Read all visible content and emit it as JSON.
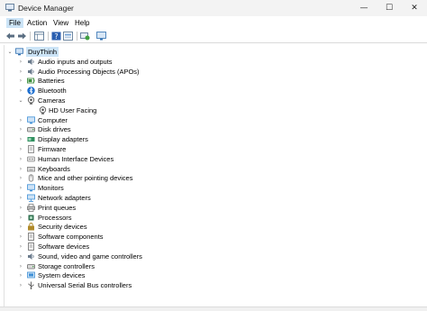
{
  "window": {
    "title": "Device Manager",
    "controls": {
      "minimize": "—",
      "maximize": "☐",
      "close": "✕"
    }
  },
  "menu": [
    {
      "label": "File"
    },
    {
      "label": "Action"
    },
    {
      "label": "View"
    },
    {
      "label": "Help"
    }
  ],
  "toolbar": [
    {
      "icon": "back-arrow-icon"
    },
    {
      "icon": "forward-arrow-icon"
    },
    {
      "icon": "properties-grid-icon"
    },
    {
      "icon": "help-question-icon"
    },
    {
      "icon": "update-driver-icon"
    },
    {
      "icon": "scan-hardware-icon"
    },
    {
      "icon": "monitor-display-icon"
    }
  ],
  "tree": {
    "root": {
      "label": "DuyThinh",
      "expanded": true
    },
    "categories": [
      {
        "label": "Audio inputs and outputs",
        "icon": "speaker-icon",
        "color": "#6b7b8c"
      },
      {
        "label": "Audio Processing Objects (APOs)",
        "icon": "speaker-icon",
        "color": "#6b7b8c"
      },
      {
        "label": "Batteries",
        "icon": "battery-icon",
        "color": "#3f8f3f"
      },
      {
        "label": "Bluetooth",
        "icon": "bluetooth-icon",
        "color": "#1e6fd0"
      },
      {
        "label": "Cameras",
        "icon": "camera-icon",
        "color": "#555555",
        "expanded": true,
        "children": [
          {
            "label": "HD User Facing",
            "icon": "camera-icon",
            "color": "#555555"
          }
        ]
      },
      {
        "label": "Computer",
        "icon": "computer-icon",
        "color": "#3d8fd6"
      },
      {
        "label": "Disk drives",
        "icon": "disk-drive-icon",
        "color": "#6b6b6b"
      },
      {
        "label": "Display adapters",
        "icon": "display-adapter-icon",
        "color": "#2f8f5f"
      },
      {
        "label": "Firmware",
        "icon": "firmware-icon",
        "color": "#7a7a7a"
      },
      {
        "label": "Human Interface Devices",
        "icon": "hid-icon",
        "color": "#8a8a8a"
      },
      {
        "label": "Keyboards",
        "icon": "keyboard-icon",
        "color": "#7a7a7a"
      },
      {
        "label": "Mice and other pointing devices",
        "icon": "mouse-icon",
        "color": "#7a7a7a"
      },
      {
        "label": "Monitors",
        "icon": "monitor-icon",
        "color": "#3d8fd6"
      },
      {
        "label": "Network adapters",
        "icon": "network-adapter-icon",
        "color": "#3d8fd6"
      },
      {
        "label": "Print queues",
        "icon": "printer-icon",
        "color": "#6b6b6b"
      },
      {
        "label": "Processors",
        "icon": "processor-icon",
        "color": "#2f6f4f"
      },
      {
        "label": "Security devices",
        "icon": "security-device-icon",
        "color": "#b08a2a"
      },
      {
        "label": "Software components",
        "icon": "software-component-icon",
        "color": "#6b6b6b"
      },
      {
        "label": "Software devices",
        "icon": "software-device-icon",
        "color": "#6b6b6b"
      },
      {
        "label": "Sound, video and game controllers",
        "icon": "speaker-icon",
        "color": "#6b7b8c"
      },
      {
        "label": "Storage controllers",
        "icon": "storage-controller-icon",
        "color": "#6b6b6b"
      },
      {
        "label": "System devices",
        "icon": "system-device-icon",
        "color": "#3d8fd6"
      },
      {
        "label": "Universal Serial Bus controllers",
        "icon": "usb-icon",
        "color": "#555555"
      }
    ]
  },
  "colors": {
    "selection": "#cce4f7",
    "accent": "#0078d4"
  }
}
